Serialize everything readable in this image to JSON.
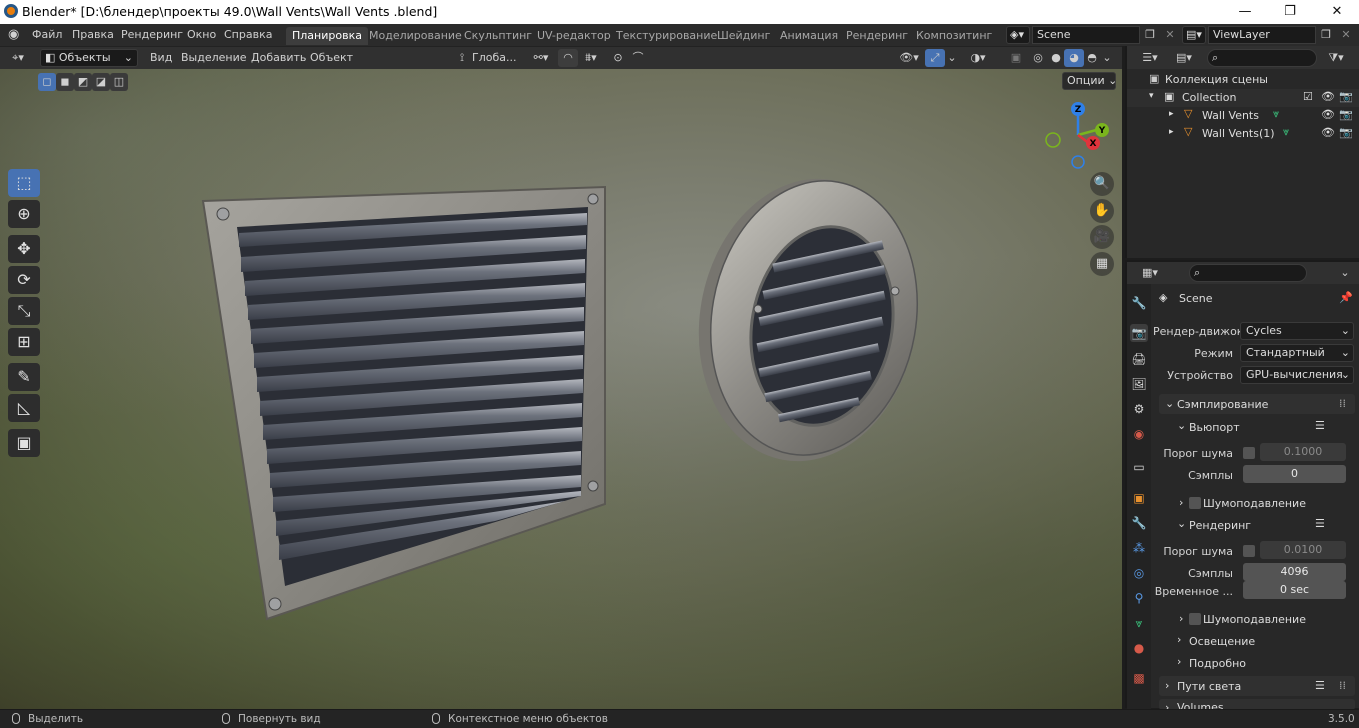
{
  "window": {
    "title": "Blender* [D:\\блендер\\проекты 49.0\\Wall Vents\\Wall Vents .blend]",
    "minimize": "—",
    "maximize": "❐",
    "close": "✕"
  },
  "menubar": {
    "items": [
      "Файл",
      "Правка",
      "Рендеринг",
      "Окно",
      "Справка"
    ],
    "workspaces": [
      "Планировка",
      "Моделирование",
      "Скульптинг",
      "UV-редактор",
      "Текстурирование",
      "Шейдинг",
      "Анимация",
      "Рендеринг",
      "Композитинг"
    ],
    "active_workspace": "Планировка",
    "scene": "Scene",
    "view_layer": "ViewLayer"
  },
  "viewport_header": {
    "mode": "Объекты",
    "menus": [
      "Вид",
      "Выделение",
      "Добавить",
      "Объект"
    ],
    "transform_orientation": "Глоба...",
    "options": "Опции"
  },
  "toolbar": {
    "tools": [
      {
        "name": "select-box",
        "glyph": "⬚"
      },
      {
        "name": "cursor",
        "glyph": "⊕"
      },
      {
        "name": "move",
        "glyph": "✥"
      },
      {
        "name": "rotate",
        "glyph": "⟳"
      },
      {
        "name": "scale",
        "glyph": "⤡"
      },
      {
        "name": "transform",
        "glyph": "⊞"
      },
      {
        "name": "annotate",
        "glyph": "✎"
      },
      {
        "name": "measure",
        "glyph": "◺"
      },
      {
        "name": "add-cube",
        "glyph": "▣"
      }
    ]
  },
  "gizmo": {
    "x": "X",
    "y": "Y",
    "z": "Z"
  },
  "navigation": {
    "zoom": "🔍",
    "pan": "✋",
    "camera": "🎥",
    "ortho": "▦"
  },
  "outliner": {
    "root": "Коллекция сцены",
    "items": [
      {
        "label": "Collection",
        "level": 1
      },
      {
        "label": "Wall Vents",
        "level": 2
      },
      {
        "label": "Wall Vents(1)",
        "level": 2
      }
    ]
  },
  "properties": {
    "scene_name": "Scene",
    "render_engine_label": "Рендер-движок",
    "render_engine": "Cycles",
    "mode_label": "Режим",
    "mode": "Стандартный",
    "device_label": "Устройство",
    "device": "GPU-вычисления",
    "sampling": "Сэмплирование",
    "viewport": "Вьюпорт",
    "noise_threshold_label": "Порог шума",
    "viewport_noise_threshold": "0.1000",
    "samples_label": "Сэмплы",
    "viewport_samples": "0",
    "denoise": "Шумоподавление",
    "render": "Рендеринг",
    "render_noise_threshold": "0.0100",
    "render_samples": "4096",
    "time_limit_label": "Временное ...",
    "time_limit": "0 sec",
    "render_denoise": "Шумоподавление",
    "lights": "Освещение",
    "advanced": "Подробно",
    "light_paths": "Пути света",
    "volumes": "Volumes"
  },
  "statusbar": {
    "select": "Выделить",
    "rotate_view": "Повернуть вид",
    "context_menu": "Контекстное меню объектов",
    "version": "3.5.0"
  },
  "colors": {
    "accent": "#4772b3",
    "header": "#303030",
    "panel": "#282828"
  }
}
